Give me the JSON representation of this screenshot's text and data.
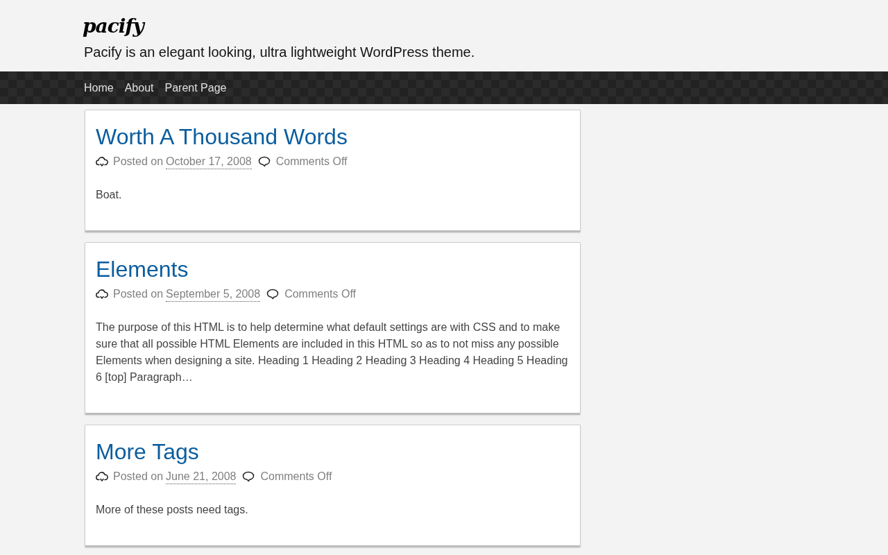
{
  "site": {
    "title": "pacify",
    "tagline": "Pacify is an elegant looking, ultra lightweight WordPress theme."
  },
  "nav": {
    "items": [
      {
        "label": "Home"
      },
      {
        "label": "About"
      },
      {
        "label": "Parent Page"
      }
    ]
  },
  "posts": [
    {
      "title": "Worth A Thousand Words",
      "posted_label": "Posted on",
      "date": "October 17, 2008",
      "comments": "Comments Off",
      "excerpt": "Boat."
    },
    {
      "title": "Elements",
      "posted_label": "Posted on",
      "date": "September 5, 2008",
      "comments": "Comments Off",
      "excerpt": "The purpose of this HTML is to help determine what default settings are with CSS and to make sure that all possible HTML Elements are included in this HTML so as to not miss any possible Elements when designing a site. Heading 1 Heading 2 Heading 3 Heading 4 Heading 5 Heading 6 [top] Paragraph…"
    },
    {
      "title": "More Tags",
      "posted_label": "Posted on",
      "date": "June 21, 2008",
      "comments": "Comments Off",
      "excerpt": "More of these posts need tags."
    }
  ]
}
